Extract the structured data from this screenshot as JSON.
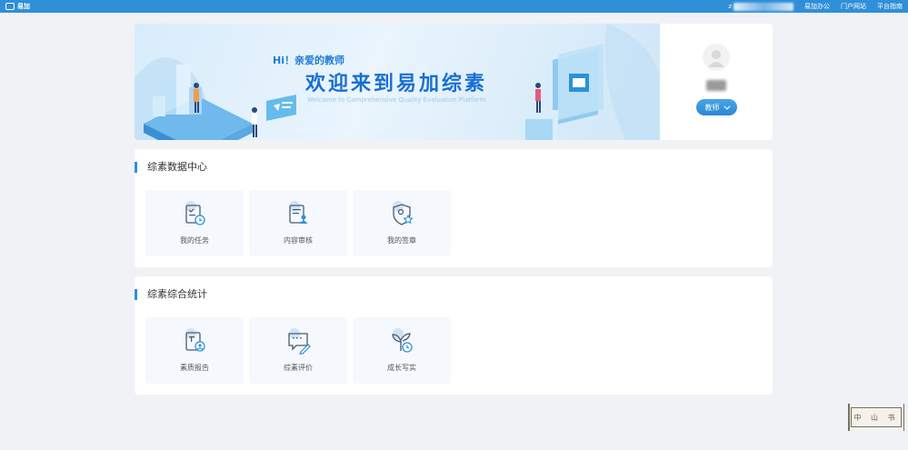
{
  "topbar": {
    "brand": "易加",
    "user_initial": "z",
    "links": [
      "易加办公",
      "门户网站",
      "平台指南"
    ]
  },
  "banner": {
    "greeting": "Hi！亲爱的教师",
    "welcome": "欢迎来到易加综素",
    "welcome_en": "Welcome to Comprehensive Quality Evaluation Platform"
  },
  "profile": {
    "role": "教师"
  },
  "sections": [
    {
      "title": "综素数据中心",
      "items": [
        {
          "label": "我的任务",
          "icon": "task-clock-icon"
        },
        {
          "label": "内容审核",
          "icon": "review-user-icon"
        },
        {
          "label": "我的签章",
          "icon": "shield-star-icon"
        }
      ]
    },
    {
      "title": "综素综合统计",
      "items": [
        {
          "label": "素质报告",
          "icon": "report-user-icon"
        },
        {
          "label": "综素评价",
          "icon": "evaluate-pen-icon"
        },
        {
          "label": "成长写实",
          "icon": "growth-plant-icon"
        }
      ]
    }
  ],
  "stamp": "中 山 书",
  "colors": {
    "accent": "#2f8fd8",
    "tile_bg": "#f5f9fd",
    "page_bg": "#f0f2f5"
  }
}
